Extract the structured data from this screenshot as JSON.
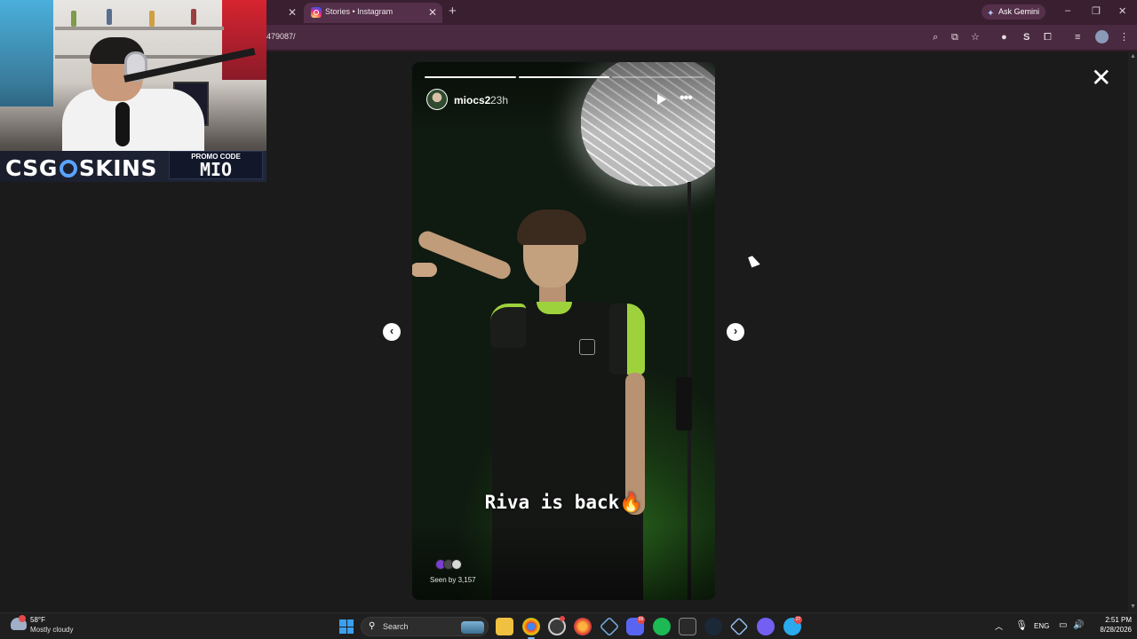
{
  "browser": {
    "active_tab_title": "Stories • Instagram",
    "url": "479087/",
    "gemini_label": "Ask Gemini",
    "profile_initial": "S"
  },
  "stream_overlay": {
    "brand": "CSG",
    "brand_suffix": "SKINS",
    "promo_label": "PROMO CODE",
    "promo_code": "MIO"
  },
  "story": {
    "username": "miocs2",
    "time_ago": "23h",
    "caption": "Riva is back",
    "caption_emoji": "🔥",
    "seen_by": "Seen by 3,157",
    "progress": [
      1.0,
      1.0,
      0.0
    ],
    "viewer_colors": [
      "#7a3fd0",
      "#4a4a4a",
      "#d8d8d8"
    ]
  },
  "taskbar": {
    "temperature": "58°F",
    "condition": "Mostly cloudy",
    "search_label": "Search",
    "language": "ENG",
    "time": "2:51 PM",
    "date": "8/28/2026",
    "badge_discord": "99",
    "badge_last": "27"
  },
  "colors": {
    "accent_tab": "#54304a",
    "tabbar": "#3a1f30",
    "toolbar": "#4a2a40"
  }
}
